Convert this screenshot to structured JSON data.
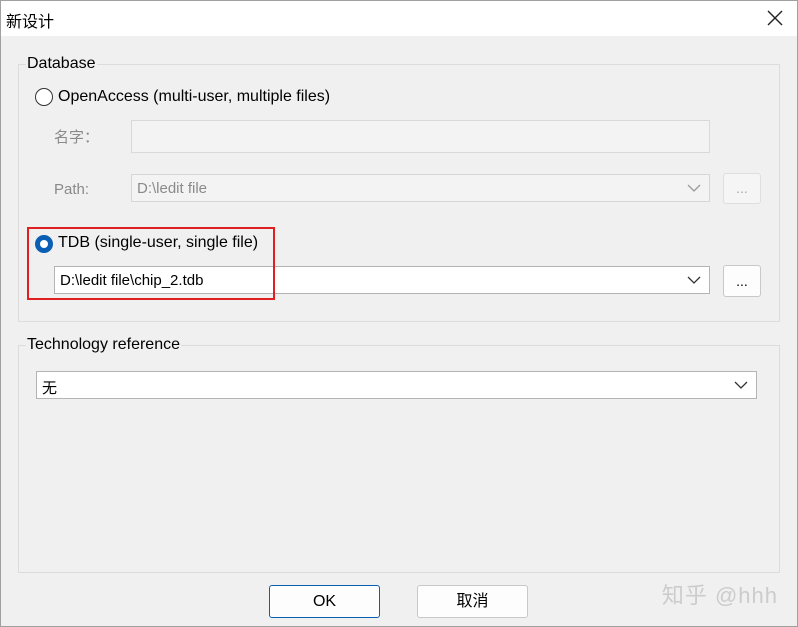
{
  "window": {
    "title": "新设计",
    "close_icon": "close-icon"
  },
  "database_group": {
    "label": "Database",
    "openaccess": {
      "label": "OpenAccess (multi-user, multiple files)",
      "selected": false,
      "name_label": "名字：",
      "name_value": "",
      "path_label": "Path:",
      "path_value": "D:\\ledit file",
      "browse_label": "..."
    },
    "tdb": {
      "label": "TDB (single-user, single file)",
      "selected": true,
      "file_value": "D:\\ledit file\\chip_2.tdb",
      "browse_label": "..."
    }
  },
  "technology_group": {
    "label": "Technology reference",
    "selected_value": "无"
  },
  "buttons": {
    "ok": "OK",
    "cancel": "取消"
  },
  "watermark": "知乎 @hhh",
  "colors": {
    "accent": "#0a5fb4",
    "highlight": "#e02020"
  }
}
